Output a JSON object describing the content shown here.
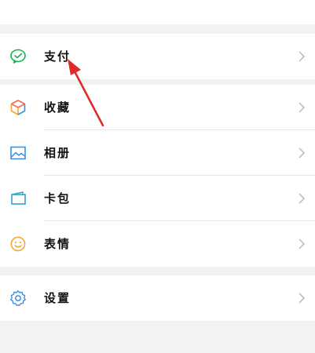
{
  "menu": {
    "pay": {
      "label": "支付",
      "icon": "wechat-pay-icon"
    },
    "items": [
      {
        "label": "收藏",
        "icon": "favorites-cube-icon"
      },
      {
        "label": "相册",
        "icon": "album-icon"
      },
      {
        "label": "卡包",
        "icon": "card-wallet-icon"
      },
      {
        "label": "表情",
        "icon": "sticker-smile-icon"
      }
    ],
    "settings": {
      "label": "设置",
      "icon": "gear-icon"
    }
  },
  "annotation": {
    "type": "red-arrow",
    "target": "支付",
    "color": "#e02b2b"
  },
  "colors": {
    "background": "#f2f2f2",
    "row": "#ffffff",
    "divider": "#e6e6e6",
    "chevron": "#b8b8b8"
  }
}
